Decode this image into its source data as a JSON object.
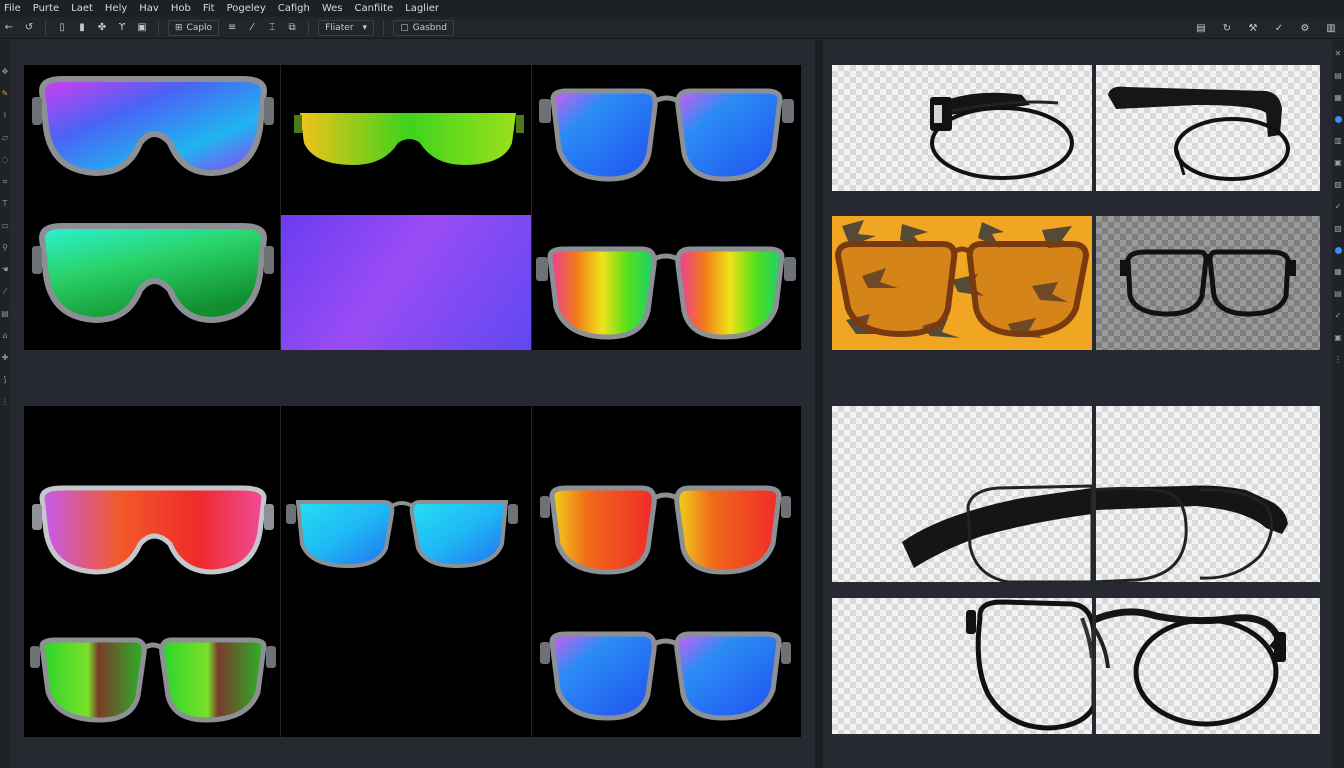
{
  "menu": [
    "File",
    "Purte",
    "Laet",
    "Hely",
    "Hav",
    "Hob",
    "Fit",
    "Pogeley",
    "Cafigh",
    "Wes",
    "Canfiite",
    "Laglier"
  ],
  "toolbar": {
    "field_a": "Caplo",
    "field_b": "Fliater",
    "field_c": "Gasbnd"
  },
  "colors": {
    "accent": "#3d8bf2",
    "canvas": "#000000",
    "chrome": "#22262b",
    "orange_tile": "#f0a623"
  },
  "icons": {
    "left": [
      "move-icon",
      "pencil-icon",
      "brush-icon",
      "eraser-icon",
      "lasso-icon",
      "crop-icon",
      "text-icon",
      "shape-icon",
      "zoom-icon",
      "hand-icon"
    ],
    "right": [
      "close-icon",
      "layers-icon",
      "adjust-icon",
      "check-icon",
      "history-icon",
      "properties-icon",
      "check-icon",
      "channels-icon"
    ]
  }
}
